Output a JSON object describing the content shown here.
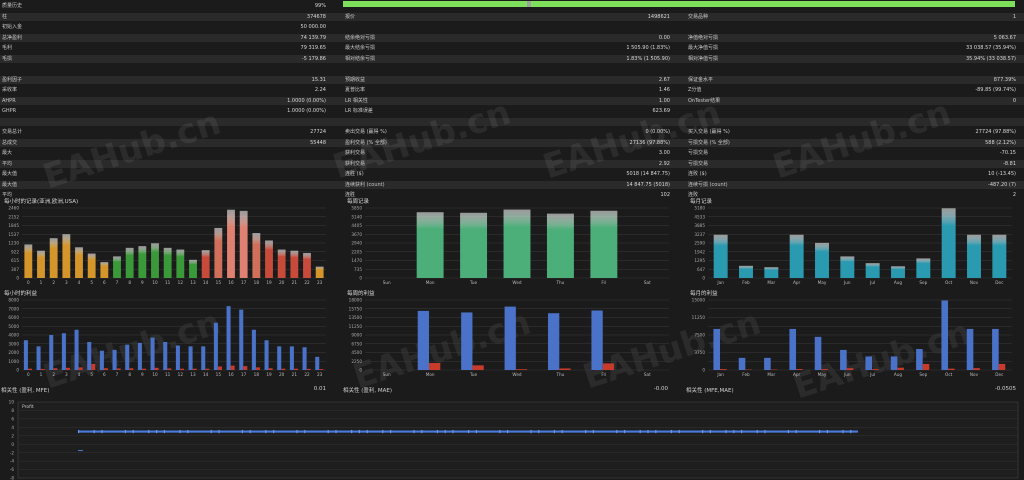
{
  "summary_rows": [
    {
      "c1": "质量历史",
      "v1": "99%"
    },
    {
      "c1": "柱",
      "v1": "374678",
      "c2": "报价",
      "v2": "1498621",
      "c3": "交易品种",
      "v3": "1"
    },
    {
      "c1": "初始入金",
      "v1": "50 000.00"
    },
    {
      "c1": "总净盈利",
      "v1": "74 139.79",
      "c2": "结余绝对亏损",
      "v2": "0.00",
      "c3": "净值绝对亏损",
      "v3": "5 063.67"
    },
    {
      "c1": "毛利",
      "v1": "79 319.65",
      "c2": "最大结余亏损",
      "v2": "1 505.90 (1.83%)",
      "c3": "最大净值亏损",
      "v3": "33 038.57 (35.94%)"
    },
    {
      "c1": "毛损",
      "v1": "-5 179.86",
      "c2": "相对结余亏损",
      "v2": "1.83% (1 505.90)",
      "c3": "相对净值亏损",
      "v3": "35.94% (33 038.57)"
    },
    {},
    {
      "c1": "盈利因子",
      "v1": "15.31",
      "c2": "预期收益",
      "v2": "2.67",
      "c3": "保证金水平",
      "v3": "877.39%"
    },
    {
      "c1": "采收率",
      "v1": "2.24",
      "c2": "夏普比率",
      "v2": "1.46",
      "c3": "Z分值",
      "v3": "-89.85 (99.74%)"
    },
    {
      "c1": "AHPR",
      "v1": "1.0000 (0.00%)",
      "c2": "LR 相关性",
      "v2": "1.00",
      "c3": "OnTester结果",
      "v3": "0"
    },
    {
      "c1": "GHPR",
      "v1": "1.0000 (0.00%)",
      "c2": "LR 标准误差",
      "v2": "623.69"
    },
    {},
    {
      "c1": "交易总计",
      "v1": "27724",
      "c2": "卖出交易 (赢得 %)",
      "v2": "0 (0.00%)",
      "c3": "买入交易 (赢得 %)",
      "v3": "27724 (97.88%)"
    },
    {
      "c1": "总成交",
      "v1": "55448",
      "c2": "盈利交易 (% 全部)",
      "v2": "27136 (97.88%)",
      "c3": "亏损交易 (% 全部)",
      "v3": "588 (2.12%)"
    },
    {
      "c1": "最大",
      "v1": "",
      "c2": "获利交易",
      "v2": "3.00",
      "c3": "亏损交易",
      "v3": "-70.15"
    },
    {
      "c1": "平均",
      "v1": "",
      "c2": "获利交易",
      "v2": "2.92",
      "c3": "亏损交易",
      "v3": "-8.81"
    },
    {
      "c1": "最大值",
      "v1": "",
      "c2": "连胜 ($)",
      "v2": "5018 (14 847.75)",
      "c3": "连败 ($)",
      "v3": "10 (-13.45)"
    },
    {
      "c1": "最大值",
      "v1": "",
      "c2": "连续获利 (count)",
      "v2": "14 847.75 (5018)",
      "c3": "连续亏损 (count)",
      "v3": "-487.20 (7)"
    },
    {
      "c1": "平均",
      "v1": "",
      "c2": "连胜",
      "v2": "102",
      "c3": "连败",
      "v3": "2"
    }
  ],
  "quality_progress": 0.99,
  "watermark": "EAHub.cn",
  "charts": [
    {
      "id": "hour_count",
      "title": "每小时的记录(亚洲,欧洲,USA)",
      "yticks": [
        "2460",
        "2152",
        "1845",
        "1537",
        "1230",
        "922",
        "615",
        "307",
        "0"
      ],
      "ymax": 2460,
      "categories": [
        "0",
        "1",
        "2",
        "3",
        "4",
        "5",
        "6",
        "7",
        "8",
        "9",
        "10",
        "11",
        "12",
        "13",
        "14",
        "15",
        "16",
        "17",
        "18",
        "19",
        "20",
        "21",
        "22",
        "23"
      ],
      "values": [
        1180,
        960,
        1400,
        1540,
        1080,
        860,
        560,
        760,
        1060,
        1120,
        1220,
        1060,
        1000,
        640,
        980,
        1760,
        2400,
        2360,
        1580,
        1320,
        1000,
        960,
        880,
        400
      ],
      "colors": [
        "#d4962a",
        "#d4962a",
        "#d4962a",
        "#d4962a",
        "#d4962a",
        "#d4962a",
        "#d4962a",
        "#3a9a3a",
        "#3a9a3a",
        "#3a9a3a",
        "#3a9a3a",
        "#3a9a3a",
        "#3a9a3a",
        "#3a9a3a",
        "#c84a3a",
        "#d0705a",
        "#e08070",
        "#e08070",
        "#d0705a",
        "#c84a3a",
        "#c84a3a",
        "#c84a3a",
        "#c84a3a",
        "#d4962a"
      ]
    },
    {
      "id": "week_count",
      "title": "每周记录",
      "yticks": [
        "5850",
        "5140",
        "4405",
        "3670",
        "2940",
        "2205",
        "1470",
        "735",
        "0"
      ],
      "ymax": 5850,
      "categories": [
        "Sun",
        "Mon",
        "Tue",
        "Wed",
        "Thu",
        "Fri",
        "Sat"
      ],
      "values": [
        0,
        5500,
        5450,
        5720,
        5380,
        5620,
        0
      ],
      "colors": [
        "#4caf7a",
        "#4caf7a",
        "#4caf7a",
        "#4caf7a",
        "#4caf7a",
        "#4caf7a",
        "#4caf7a"
      ]
    },
    {
      "id": "month_count",
      "title": "每月记录",
      "yticks": [
        "5180",
        "4533",
        "3885",
        "3237",
        "2590",
        "1942",
        "1295",
        "647",
        "0"
      ],
      "ymax": 5180,
      "categories": [
        "Jan",
        "Feb",
        "Mar",
        "Apr",
        "May",
        "Jun",
        "Jul",
        "Aug",
        "Sep",
        "Oct",
        "Nov",
        "Dec"
      ],
      "values": [
        3200,
        900,
        800,
        3200,
        2600,
        1600,
        1100,
        870,
        1450,
        5160,
        3200,
        3200
      ],
      "colors": [
        "#2a9ab0",
        "#2a9ab0",
        "#2a9ab0",
        "#2a9ab0",
        "#2a9ab0",
        "#2a9ab0",
        "#2a9ab0",
        "#2a9ab0",
        "#2a9ab0",
        "#2a9ab0",
        "#2a9ab0",
        "#2a9ab0"
      ]
    },
    {
      "id": "hour_profit",
      "title": "每小时的利益",
      "yticks": [
        "8000",
        "7000",
        "6000",
        "5000",
        "4000",
        "3000",
        "2000",
        "1000",
        "0"
      ],
      "ymax": 8000,
      "categories": [
        "0",
        "1",
        "2",
        "3",
        "4",
        "5",
        "6",
        "7",
        "8",
        "9",
        "10",
        "11",
        "12",
        "13",
        "14",
        "15",
        "16",
        "17",
        "18",
        "19",
        "20",
        "21",
        "22",
        "23"
      ],
      "series": [
        {
          "values": [
            3400,
            2700,
            4000,
            4200,
            4600,
            3200,
            2200,
            2300,
            2900,
            3100,
            3700,
            3200,
            2800,
            2700,
            2700,
            5400,
            7300,
            6900,
            4600,
            3400,
            2700,
            2700,
            2600,
            1500
          ],
          "color": "#4a72c8"
        },
        {
          "values": [
            150,
            120,
            200,
            250,
            300,
            700,
            200,
            180,
            200,
            150,
            250,
            180,
            150,
            150,
            150,
            400,
            500,
            450,
            300,
            200,
            150,
            150,
            130,
            100
          ],
          "color": "#c83a2a"
        }
      ]
    },
    {
      "id": "week_profit",
      "title": "每周的利益",
      "yticks": [
        "18000",
        "15750",
        "13500",
        "11250",
        "9000",
        "6750",
        "4500",
        "2250",
        "0"
      ],
      "ymax": 18000,
      "categories": [
        "Sun",
        "Mon",
        "Tue",
        "Wed",
        "Thu",
        "Fri",
        "Sat"
      ],
      "series": [
        {
          "values": [
            0,
            15200,
            14800,
            16300,
            14600,
            15300,
            0
          ],
          "color": "#4a72c8"
        },
        {
          "values": [
            0,
            1800,
            1200,
            200,
            400,
            1700,
            0
          ],
          "color": "#c83a2a"
        }
      ]
    },
    {
      "id": "month_profit",
      "title": "每月的利益",
      "yticks": [
        "15000",
        "",
        "11250",
        "",
        "7500",
        "",
        "3750",
        "",
        "0"
      ],
      "ymax": 15000,
      "categories": [
        "Jan",
        "Feb",
        "Mar",
        "Apr",
        "May",
        "Jun",
        "Jul",
        "Aug",
        "Sep",
        "Oct",
        "Nov",
        "Dec"
      ],
      "series": [
        {
          "values": [
            8800,
            2600,
            2600,
            8800,
            7100,
            4300,
            2900,
            2900,
            4500,
            14900,
            8800,
            8800
          ],
          "color": "#4a72c8"
        },
        {
          "values": [
            200,
            100,
            100,
            200,
            200,
            400,
            200,
            500,
            1300,
            300,
            400,
            1300
          ],
          "color": "#c83a2a"
        }
      ]
    }
  ],
  "correlation": [
    {
      "label": "相关性 (盈利, MFE)",
      "value": "0.01"
    },
    {
      "label": "相关性 (盈利, MAE)",
      "value": "-0.00"
    },
    {
      "label": "相关性 (MFE,MAE)",
      "value": "-0.0505"
    }
  ],
  "scatter": {
    "legend": "Profit",
    "yticks": [
      "10",
      "8",
      "6",
      "4",
      "2",
      "0",
      "-2",
      "-4",
      "-6",
      "-8"
    ],
    "ymin": -8,
    "ymax": 10,
    "line_y": 3,
    "xstart": 0.06,
    "xend": 0.84,
    "outlier": {
      "x": 0.06,
      "y": -1.5
    }
  }
}
